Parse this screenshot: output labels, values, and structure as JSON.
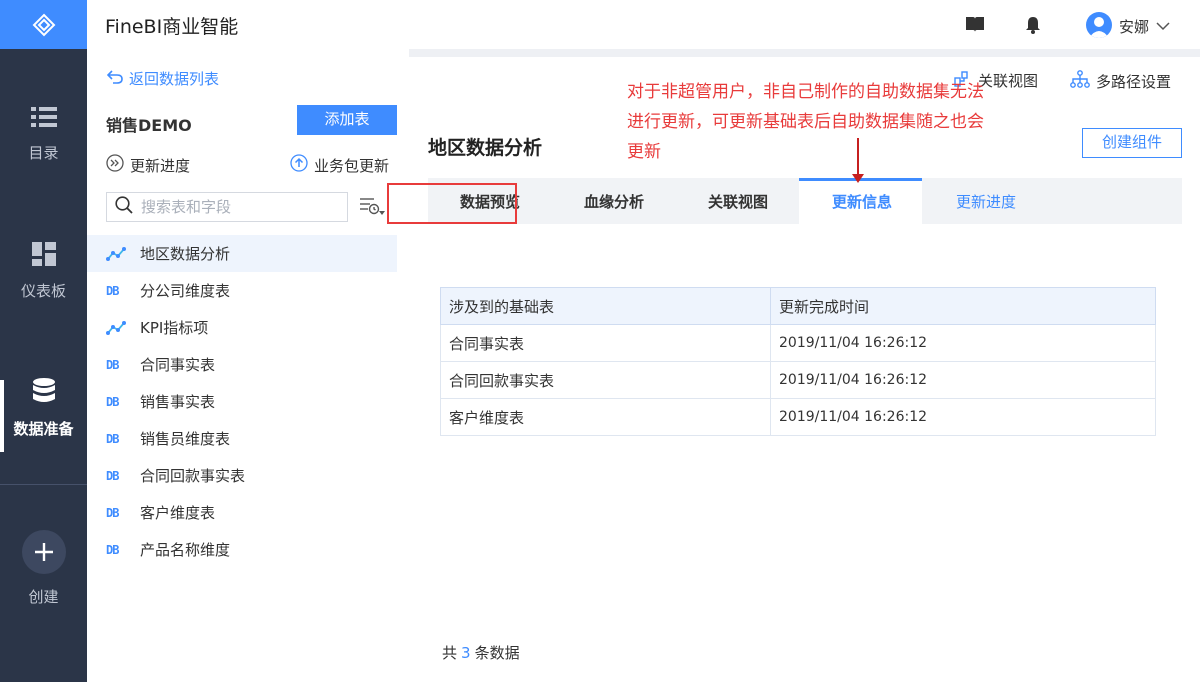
{
  "nav": {
    "items": [
      {
        "label": "目录",
        "icon": "list-icon"
      },
      {
        "label": "仪表板",
        "icon": "dashboard-icon"
      },
      {
        "label": "数据准备",
        "icon": "database-icon",
        "active": true
      }
    ],
    "create_label": "创建"
  },
  "header": {
    "app_title": "FineBI商业智能",
    "user_name": "安娜"
  },
  "left_panel": {
    "back_label": "返回数据列表",
    "package_title": "销售DEMO",
    "add_table_label": "添加表",
    "update_progress_label": "更新进度",
    "package_update_label": "业务包更新",
    "search_placeholder": "搜索表和字段",
    "tables": [
      {
        "name": "地区数据分析",
        "icon": "self-dataset-icon",
        "active": true
      },
      {
        "name": "分公司维度表",
        "icon": "db-icon"
      },
      {
        "name": "KPI指标项",
        "icon": "self-dataset-icon"
      },
      {
        "name": "合同事实表",
        "icon": "db-icon"
      },
      {
        "name": "销售事实表",
        "icon": "db-icon"
      },
      {
        "name": "销售员维度表",
        "icon": "db-icon"
      },
      {
        "name": "合同回款事实表",
        "icon": "db-icon"
      },
      {
        "name": "客户维度表",
        "icon": "db-icon"
      },
      {
        "name": "产品名称维度",
        "icon": "db-icon"
      }
    ]
  },
  "toolbar": {
    "relation_view_label": "关联视图",
    "multipath_label": "多路径设置"
  },
  "main": {
    "dataset_title": "地区数据分析",
    "create_component_label": "创建组件",
    "tabs": [
      {
        "label": "数据预览"
      },
      {
        "label": "血缘分析"
      },
      {
        "label": "关联视图"
      },
      {
        "label": "更新信息",
        "active": true
      },
      {
        "label": "更新进度"
      }
    ],
    "table": {
      "headers": [
        "涉及到的基础表",
        "更新完成时间"
      ],
      "rows": [
        [
          "合同事实表",
          "2019/11/04 16:26:12"
        ],
        [
          "合同回款事实表",
          "2019/11/04 16:26:12"
        ],
        [
          "客户维度表",
          "2019/11/04 16:26:12"
        ]
      ]
    },
    "footer": {
      "prefix": "共",
      "count": "3",
      "suffix": "条数据"
    }
  },
  "annotation": {
    "text": "对于非超管用户，非自己制作的自助数据集无法进行更新，可更新基础表后自助数据集随之也会更新",
    "color": "#e83b3b"
  },
  "colors": {
    "accent": "#3f8cff",
    "nav_bg": "#2b3548",
    "annotation": "#e83b3b"
  }
}
